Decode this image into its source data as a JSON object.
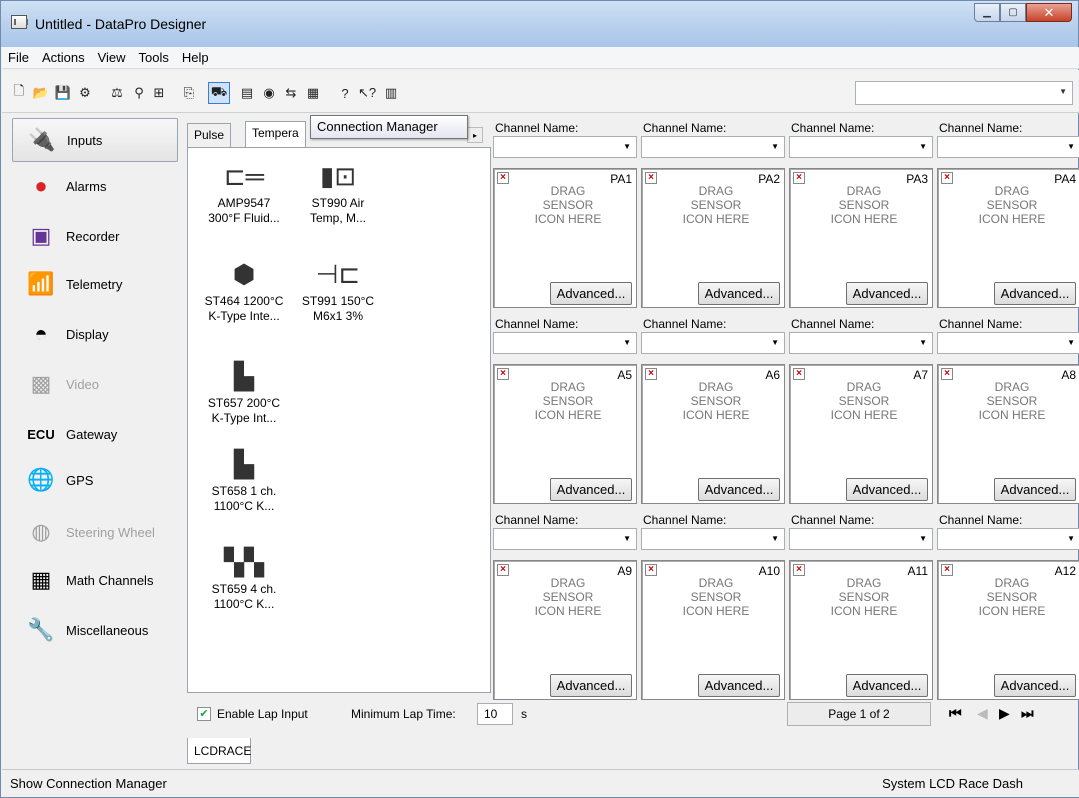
{
  "window": {
    "title": "Untitled - DataPro Designer"
  },
  "menu": [
    "File",
    "Actions",
    "View",
    "Tools",
    "Help"
  ],
  "tooltip": "Connection Manager",
  "sidebar": [
    {
      "label": "Inputs",
      "icon": "inputs-icon",
      "selected": true
    },
    {
      "label": "Alarms",
      "icon": "alarm-bell-icon"
    },
    {
      "label": "Recorder",
      "icon": "recorder-icon"
    },
    {
      "label": "Telemetry",
      "icon": "telemetry-icon"
    },
    {
      "label": "Display",
      "icon": "display-gauge-icon"
    },
    {
      "label": "Video",
      "icon": "video-icon",
      "disabled": true
    },
    {
      "label": "Gateway",
      "icon": "ecu-gateway-icon"
    },
    {
      "label": "GPS",
      "icon": "gps-globe-icon"
    },
    {
      "label": "Steering Wheel",
      "icon": "steering-wheel-icon",
      "disabled": true
    },
    {
      "label": "Math Channels",
      "icon": "calculator-icon"
    },
    {
      "label": "Miscellaneous",
      "icon": "tools-icon"
    }
  ],
  "tabs": [
    "Pulse",
    "Tempera"
  ],
  "sensors": [
    {
      "line1": "AMP9547",
      "line2": "300°F Fluid..."
    },
    {
      "line1": "ST990 Air",
      "line2": "Temp, M..."
    },
    {
      "line1": "ST464 1200°C",
      "line2": "K-Type Inte..."
    },
    {
      "line1": "ST991 150°C",
      "line2": "M6x1 3%"
    },
    {
      "line1": "ST657 200°C",
      "line2": "K-Type Int..."
    },
    {
      "line1": "ST658 1 ch.",
      "line2": "1100°C K..."
    },
    {
      "line1": "ST659 4 ch.",
      "line2": "1100°C K..."
    }
  ],
  "grid": {
    "channel_label": "Channel Name:",
    "drag_text": [
      "DRAG",
      "SENSOR",
      "ICON HERE"
    ],
    "advanced_label": "Advanced...",
    "channels": [
      "PA1",
      "PA2",
      "PA3",
      "PA4",
      "A5",
      "A6",
      "A7",
      "A8",
      "A9",
      "A10",
      "A11",
      "A12"
    ]
  },
  "bottom": {
    "enable_lap_label": "Enable Lap Input",
    "enable_lap_checked": true,
    "min_lap_label": "Minimum Lap Time:",
    "min_lap_value": "10",
    "min_lap_unit": "s",
    "page_text": "Page 1 of 2"
  },
  "bottom_tab": "LCDRACE",
  "status": {
    "left": "Show Connection Manager",
    "right": "System  LCD Race Dash"
  }
}
